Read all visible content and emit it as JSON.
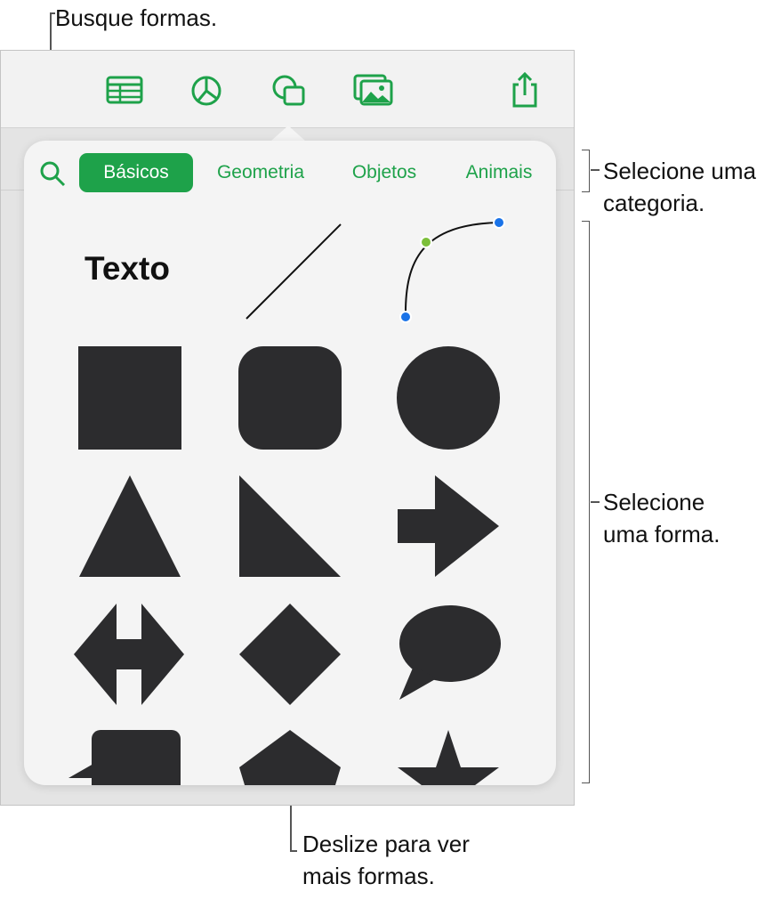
{
  "callouts": {
    "search": "Busque formas.",
    "category_line1": "Selecione uma",
    "category_line2": "categoria.",
    "shape_line1": "Selecione",
    "shape_line2": "uma forma.",
    "scroll_line1": "Deslize para ver",
    "scroll_line2": "mais formas."
  },
  "toolbar": {
    "icons": [
      "table-icon",
      "chart-icon",
      "shapes-icon",
      "media-icon",
      "share-icon"
    ]
  },
  "tabs": {
    "items": [
      "Básicos",
      "Geometria",
      "Objetos",
      "Animais"
    ],
    "active": "Básicos"
  },
  "shapes": {
    "text_label": "Texto",
    "items": [
      "text",
      "line",
      "curve",
      "square",
      "rounded-square",
      "circle",
      "triangle",
      "right-triangle",
      "arrow",
      "double-arrow",
      "diamond",
      "speech-bubble",
      "callout-box",
      "pentagon",
      "star"
    ]
  },
  "colors": {
    "accent": "#1ea24a",
    "shape_fill": "#2c2c2e",
    "curve_mid_dot": "#7cbf3a",
    "curve_end_dot": "#1a73e8"
  }
}
